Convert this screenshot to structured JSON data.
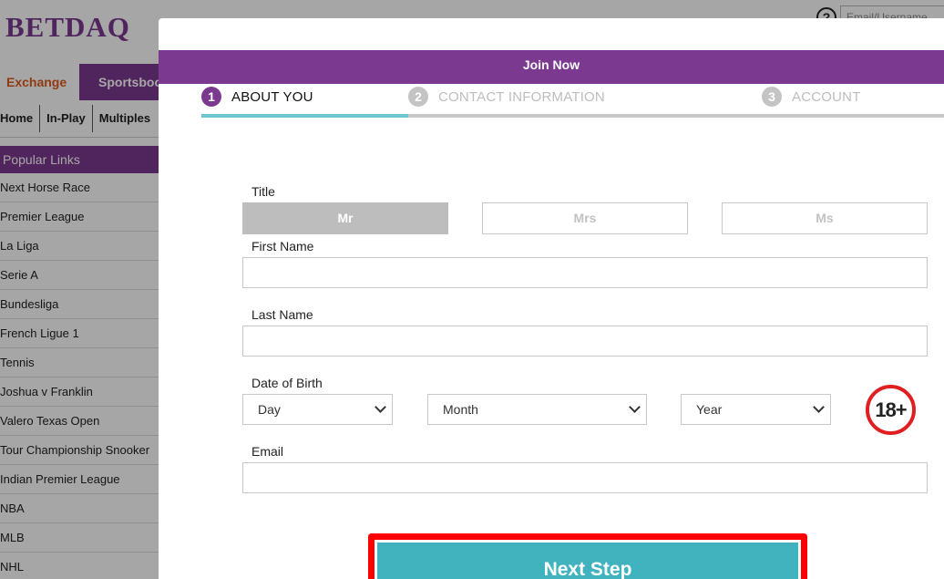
{
  "background": {
    "logo": "BETDAQ",
    "header_email_placeholder": "Email/Username",
    "top_tabs": [
      "Exchange",
      "Sportsbook"
    ],
    "subnav": [
      "Home",
      "In-Play",
      "Multiples"
    ],
    "sidebar": {
      "header": "Popular Links",
      "links": [
        "Next Horse Race",
        "Premier League",
        "La Liga",
        "Serie A",
        "Bundesliga",
        "French Ligue 1",
        "Tennis",
        "Joshua v Franklin",
        "Valero Texas Open",
        "Tour Championship Snooker",
        "Indian Premier League",
        "NBA",
        "MLB",
        "NHL"
      ]
    }
  },
  "modal": {
    "title": "Join Now",
    "steps": [
      {
        "number": "1",
        "label": "ABOUT YOU",
        "active": true
      },
      {
        "number": "2",
        "label": "CONTACT INFORMATION",
        "active": false
      },
      {
        "number": "3",
        "label": "ACCOUNT",
        "active": false
      }
    ],
    "form": {
      "title_label": "Title",
      "title_options": [
        "Mr",
        "Mrs",
        "Ms"
      ],
      "title_selected": "Mr",
      "first_name_label": "First Name",
      "first_name_value": "",
      "last_name_label": "Last Name",
      "last_name_value": "",
      "dob_label": "Date of Birth",
      "dob_day": "Day",
      "dob_month": "Month",
      "dob_year": "Year",
      "age_badge": "18+",
      "email_label": "Email",
      "email_value": ""
    },
    "next_button": "Next Step"
  },
  "colors": {
    "brand_purple": "#7b3a8f",
    "progress_teal": "#6cc6d4",
    "button_teal": "#41b3bf",
    "highlight_red": "#ff0000"
  }
}
